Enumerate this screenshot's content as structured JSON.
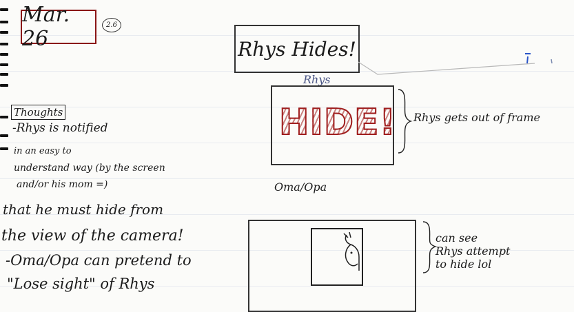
{
  "date": "Mar. 26",
  "date_circle": "2.6",
  "title": "Rhys Hides!",
  "rhys_label": "Rhys",
  "hide_word": "HIDE!",
  "frame_note": "Rhys gets out of frame",
  "cams_label": "Oma/Opa",
  "cams_note_lines": [
    "can see",
    "Rhys attempt",
    "to hide lol"
  ],
  "thoughts_title": "Thoughts",
  "thoughts_lines": [
    "-Rhys is notified",
    "in an easy to",
    "understand way (by the screen",
    "and/or his mom =)",
    "that he must hide from",
    "the view of the camera!",
    "-Oma/Opa can pretend to",
    "\"Lose sight\" of Rhys"
  ]
}
